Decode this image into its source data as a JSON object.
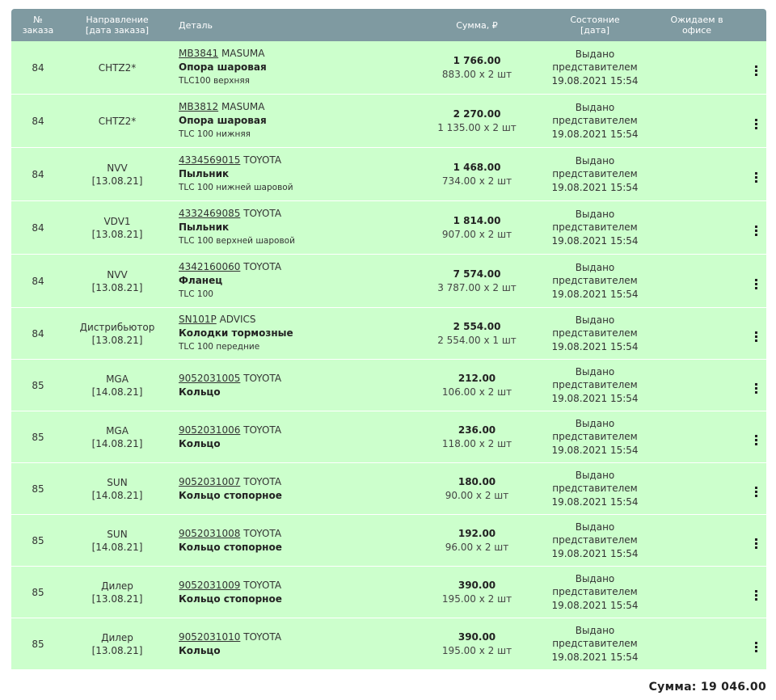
{
  "header": {
    "num": "№\nзаказа",
    "num_l1": "№",
    "num_l2": "заказа",
    "dir_l1": "Направление",
    "dir_l2": "[дата заказа]",
    "detail": "Деталь",
    "sum": "Сумма, ₽",
    "state_l1": "Состояние",
    "state_l2": "[дата]",
    "office_l1": "Ожидаем в",
    "office_l2": "офисе"
  },
  "rows": [
    {
      "order": "84",
      "dir": "CHTZ2*",
      "date": "",
      "code": "MB3841",
      "brand": "MASUMA",
      "name": "Опора шаровая",
      "note": "TLC100 верхняя",
      "total": "1 766.00",
      "qty": "883.00 x 2 шт",
      "s1": "Выдано",
      "s2": "представителем",
      "s3": "19.08.2021 15:54"
    },
    {
      "order": "84",
      "dir": "CHTZ2*",
      "date": "",
      "code": "MB3812",
      "brand": "MASUMA",
      "name": "Опора шаровая",
      "note": "TLC 100 нижняя",
      "total": "2 270.00",
      "qty": "1 135.00 x 2 шт",
      "s1": "Выдано",
      "s2": "представителем",
      "s3": "19.08.2021 15:54"
    },
    {
      "order": "84",
      "dir": "NVV",
      "date": "[13.08.21]",
      "code": "4334569015",
      "brand": "TOYOTA",
      "name": "Пыльник",
      "note": "TLC 100 нижней шаровой",
      "total": "1 468.00",
      "qty": "734.00 x 2 шт",
      "s1": "Выдано",
      "s2": "представителем",
      "s3": "19.08.2021 15:54"
    },
    {
      "order": "84",
      "dir": "VDV1",
      "date": "[13.08.21]",
      "code": "4332469085",
      "brand": "TOYOTA",
      "name": "Пыльник",
      "note": "TLC 100 верхней шаровой",
      "total": "1 814.00",
      "qty": "907.00 x 2 шт",
      "s1": "Выдано",
      "s2": "представителем",
      "s3": "19.08.2021 15:54"
    },
    {
      "order": "84",
      "dir": "NVV",
      "date": "[13.08.21]",
      "code": "4342160060",
      "brand": "TOYOTA",
      "name": "Фланец",
      "note": "TLC 100",
      "total": "7 574.00",
      "qty": "3 787.00 x 2 шт",
      "s1": "Выдано",
      "s2": "представителем",
      "s3": "19.08.2021 15:54"
    },
    {
      "order": "84",
      "dir": "Дистрибьютор",
      "date": "[13.08.21]",
      "code": "SN101P",
      "brand": "ADVICS",
      "name": "Колодки тормозные",
      "note": "TLC 100 передние",
      "total": "2 554.00",
      "qty": "2 554.00 x 1 шт",
      "s1": "Выдано",
      "s2": "представителем",
      "s3": "19.08.2021 15:54"
    },
    {
      "order": "85",
      "dir": "MGA",
      "date": "[14.08.21]",
      "code": "9052031005",
      "brand": "TOYOTA",
      "name": "Кольцо",
      "note": "",
      "total": "212.00",
      "qty": "106.00 x 2 шт",
      "s1": "Выдано",
      "s2": "представителем",
      "s3": "19.08.2021 15:54"
    },
    {
      "order": "85",
      "dir": "MGA",
      "date": "[14.08.21]",
      "code": "9052031006",
      "brand": "TOYOTA",
      "name": "Кольцо",
      "note": "",
      "total": "236.00",
      "qty": "118.00 x 2 шт",
      "s1": "Выдано",
      "s2": "представителем",
      "s3": "19.08.2021 15:54"
    },
    {
      "order": "85",
      "dir": "SUN",
      "date": "[14.08.21]",
      "code": "9052031007",
      "brand": "TOYOTA",
      "name": "Кольцо стопорное",
      "note": "",
      "total": "180.00",
      "qty": "90.00 x 2 шт",
      "s1": "Выдано",
      "s2": "представителем",
      "s3": "19.08.2021 15:54"
    },
    {
      "order": "85",
      "dir": "SUN",
      "date": "[14.08.21]",
      "code": "9052031008",
      "brand": "TOYOTA",
      "name": "Кольцо стопорное",
      "note": "",
      "total": "192.00",
      "qty": "96.00 x 2 шт",
      "s1": "Выдано",
      "s2": "представителем",
      "s3": "19.08.2021 15:54"
    },
    {
      "order": "85",
      "dir": "Дилер",
      "date": "[13.08.21]",
      "code": "9052031009",
      "brand": "TOYOTA",
      "name": "Кольцо стопорное",
      "note": "",
      "total": "390.00",
      "qty": "195.00 x 2 шт",
      "s1": "Выдано",
      "s2": "представителем",
      "s3": "19.08.2021 15:54"
    },
    {
      "order": "85",
      "dir": "Дилер",
      "date": "[13.08.21]",
      "code": "9052031010",
      "brand": "TOYOTA",
      "name": "Кольцо",
      "note": "",
      "total": "390.00",
      "qty": "195.00 x 2 шт",
      "s1": "Выдано",
      "s2": "представителем",
      "s3": "19.08.2021 15:54"
    }
  ],
  "footer": {
    "label": "Сумма:",
    "value": "19 046.00"
  },
  "colors": {
    "header_bg": "#7f9aa1",
    "row_bg": "#ccffcc"
  },
  "icons": {
    "row_menu": "vertical-dots-icon"
  }
}
